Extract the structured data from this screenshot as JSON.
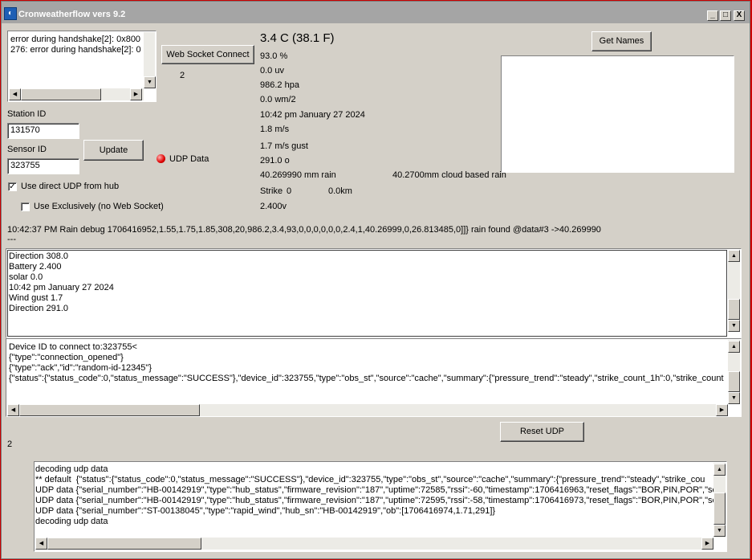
{
  "window": {
    "title": "Cronweatherflow vers 9.2",
    "min_label": "_",
    "max_label": "□",
    "close_label": "X"
  },
  "error_log": [
    "error during handshake[2]: 0x800",
    "276: error during handshake[2]: 0"
  ],
  "ws_button": "Web Socket Connect",
  "ws_count": "2",
  "station_label": "Station ID",
  "station_value": "131570",
  "sensor_label": "Sensor ID",
  "sensor_value": "323755",
  "update_button": "Update",
  "udp_led_label": "UDP Data",
  "udp_direct": {
    "label": "Use direct UDP from hub",
    "checked": "✓"
  },
  "use_exclusive": {
    "label": "Use Exclusively (no Web Socket)",
    "checked": ""
  },
  "readings": {
    "temperature": "3.4 C (38.1 F)",
    "humidity": "93.0 %",
    "uv": "0.0 uv",
    "pressure": "986.2 hpa",
    "solar": "0.0 wm/2",
    "datetime": "10:42 pm January 27 2024",
    "wind": "1.8 m/s",
    "gust": "1.7 m/s gust",
    "direction": "291.0 o",
    "rain": "40.269990 mm rain",
    "cloud_rain": "40.2700mm cloud based rain",
    "strike_label": "Strike",
    "strike_count": "0",
    "strike_dist": "0.0km",
    "voltage": "2.400v"
  },
  "get_names_button": "Get Names",
  "rain_debug": "10:42:37 PM Rain debug 1706416952,1.55,1.75,1.85,308,20,986.2,3.4,93,0,0,0,0,0,0,2.4,1,40.26999,0,26.813485,0]]} rain found @data#3 ->40.269990",
  "rain_debug_2": "---",
  "log1": [
    "Direction 308.0",
    "Battery 2.400",
    "solar 0.0",
    "10:42 pm January 27 2024",
    "Wind gust 1.7",
    "Direction 291.0"
  ],
  "log2": [
    "Device ID to connect to:323755<",
    "{\"type\":\"connection_opened\"}",
    "{\"type\":\"ack\",\"id\":\"random-id-12345\"}",
    "{\"status\":{\"status_code\":0,\"status_message\":\"SUCCESS\"},\"device_id\":323755,\"type\":\"obs_st\",\"source\":\"cache\",\"summary\":{\"pressure_trend\":\"steady\",\"strike_count_1h\":0,\"strike_count"
  ],
  "reset_udp_button": "Reset UDP",
  "udp_count": "2",
  "log3": [
    "decoding udp data",
    "** default  {\"status\":{\"status_code\":0,\"status_message\":\"SUCCESS\"},\"device_id\":323755,\"type\":\"obs_st\",\"source\":\"cache\",\"summary\":{\"pressure_trend\":\"steady\",\"strike_cou",
    "UDP data {\"serial_number\":\"HB-00142919\",\"type\":\"hub_status\",\"firmware_revision\":\"187\",\"uptime\":72585,\"rssi\":-60,\"timestamp\":1706416963,\"reset_flags\":\"BOR,PIN,POR\",\"se",
    "UDP data {\"serial_number\":\"HB-00142919\",\"type\":\"hub_status\",\"firmware_revision\":\"187\",\"uptime\":72595,\"rssi\":-58,\"timestamp\":1706416973,\"reset_flags\":\"BOR,PIN,POR\",\"se",
    "UDP data {\"serial_number\":\"ST-00138045\",\"type\":\"rapid_wind\",\"hub_sn\":\"HB-00142919\",\"ob\":[1706416974,1.71,291]}",
    "decoding udp data"
  ],
  "colors": {
    "titlebar": "#a5a5a5",
    "face": "#d4d0c8",
    "led": "#e00000",
    "border": "#cc0000"
  },
  "icons": {
    "app": "weatherflow-app-icon",
    "led": "udp-led-icon"
  }
}
